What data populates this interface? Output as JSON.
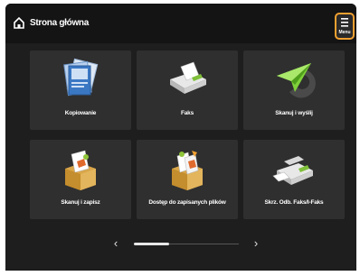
{
  "header": {
    "title": "Strona główna",
    "home_icon": "home-icon",
    "menu_label": "Menu",
    "menu_icon": "menu-icon"
  },
  "tiles": [
    {
      "label": "Kopiowanie",
      "icon": "copy-icon"
    },
    {
      "label": "Faks",
      "icon": "fax-icon"
    },
    {
      "label": "Skanuj i wyślij",
      "icon": "scan-send-icon"
    },
    {
      "label": "Skanuj i zapisz",
      "icon": "scan-store-icon"
    },
    {
      "label": "Dostęp do zapisanych plików",
      "icon": "stored-files-icon"
    },
    {
      "label": "Skrz. Odb. Faks/I-Faks",
      "icon": "fax-inbox-icon"
    }
  ],
  "pager": {
    "page": 1,
    "pages": 3,
    "prev_icon": "chevron-left-icon",
    "next_icon": "chevron-right-icon"
  },
  "colors": {
    "background": "#1e1e1e",
    "header": "#141414",
    "tile": "#2f2f2f",
    "menu_highlight": "#f0a030"
  }
}
